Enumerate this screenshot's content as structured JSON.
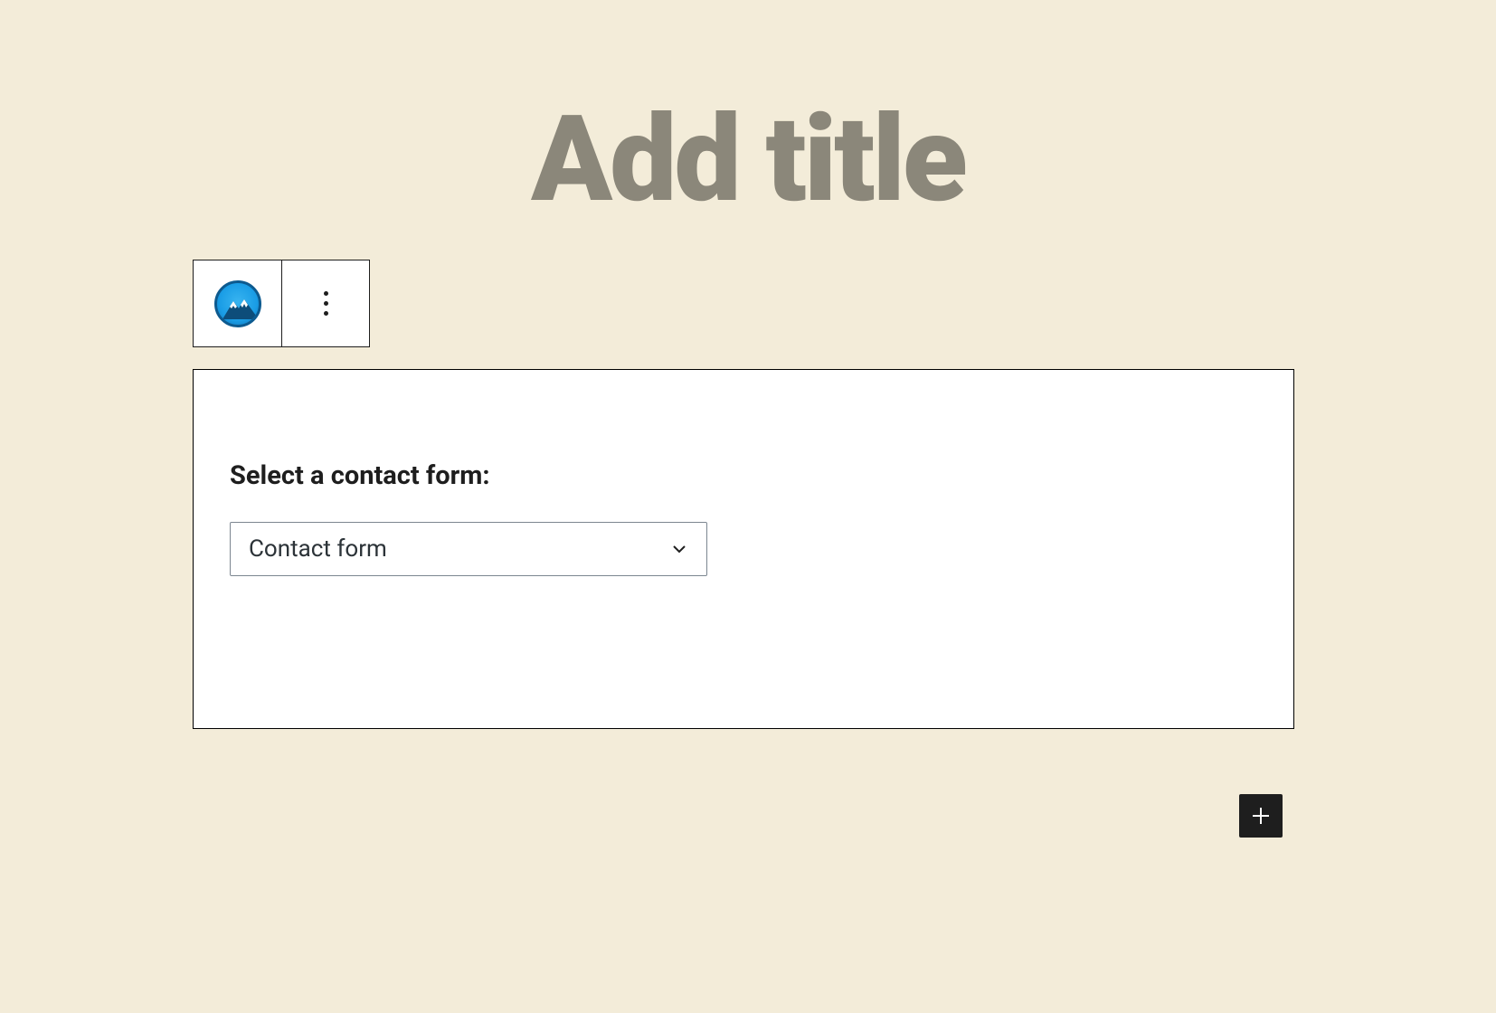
{
  "title": {
    "placeholder": "Add title"
  },
  "block": {
    "label": "Select a contact form:",
    "select": {
      "selected_value": "Contact form"
    }
  }
}
